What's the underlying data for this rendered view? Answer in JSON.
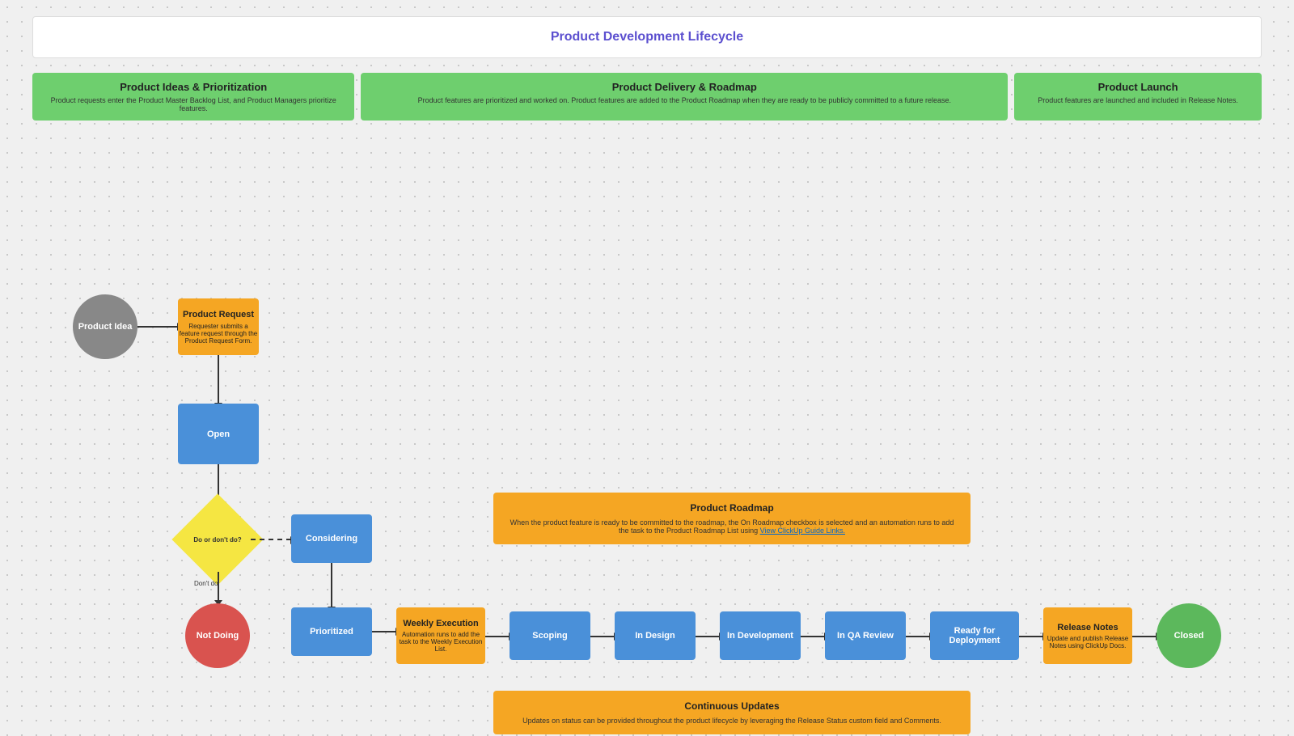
{
  "title": "Product Development Lifecycle",
  "header_sections": [
    {
      "label": "Product Ideas & Prioritization",
      "description": "Product requests enter the Product Master Backlog List, and Product Managers prioritize features.",
      "width": "narrow"
    },
    {
      "label": "Product Delivery & Roadmap",
      "description": "Product features are prioritized and worked on. Product features are added to the Product Roadmap when they are ready to be publicly committed to a future release.",
      "width": "wide"
    },
    {
      "label": "Product Launch",
      "description": "Product features are launched and included in Release Notes.",
      "width": "narrow"
    }
  ],
  "nodes": {
    "product_idea": "Product Idea",
    "product_request": "Product Request",
    "product_request_desc": "Requester submits a feature request through the Product Request Form.",
    "open": "Open",
    "do_or_dont": "Do or don't do?",
    "considering": "Considering",
    "not_doing": "Not Doing",
    "prioritized": "Prioritized",
    "weekly_execution": "Weekly Execution",
    "weekly_execution_desc": "Automation runs to add the task to the Weekly Execution List.",
    "scoping": "Scoping",
    "in_design": "In Design",
    "in_development": "In Development",
    "in_qa_review": "In QA Review",
    "ready_for_deployment": "Ready for Deployment",
    "release_notes": "Release Notes",
    "release_notes_desc": "Update and publish Release Notes using ClickUp Docs.",
    "closed": "Closed",
    "dont_do": "Don't do"
  },
  "banners": {
    "product_roadmap": {
      "title": "Product Roadmap",
      "description": "When the product feature is ready to be committed to the roadmap, the On Roadmap checkbox is selected and an automation runs to add the task to the Product Roadmap List using",
      "link_text": "View ClickUp Guide Links.",
      "link_href": "#"
    },
    "continuous_updates": {
      "title": "Continuous Updates",
      "description": "Updates on status can be provided throughout the product lifecycle by leveraging the Release Status custom field and Comments."
    }
  }
}
